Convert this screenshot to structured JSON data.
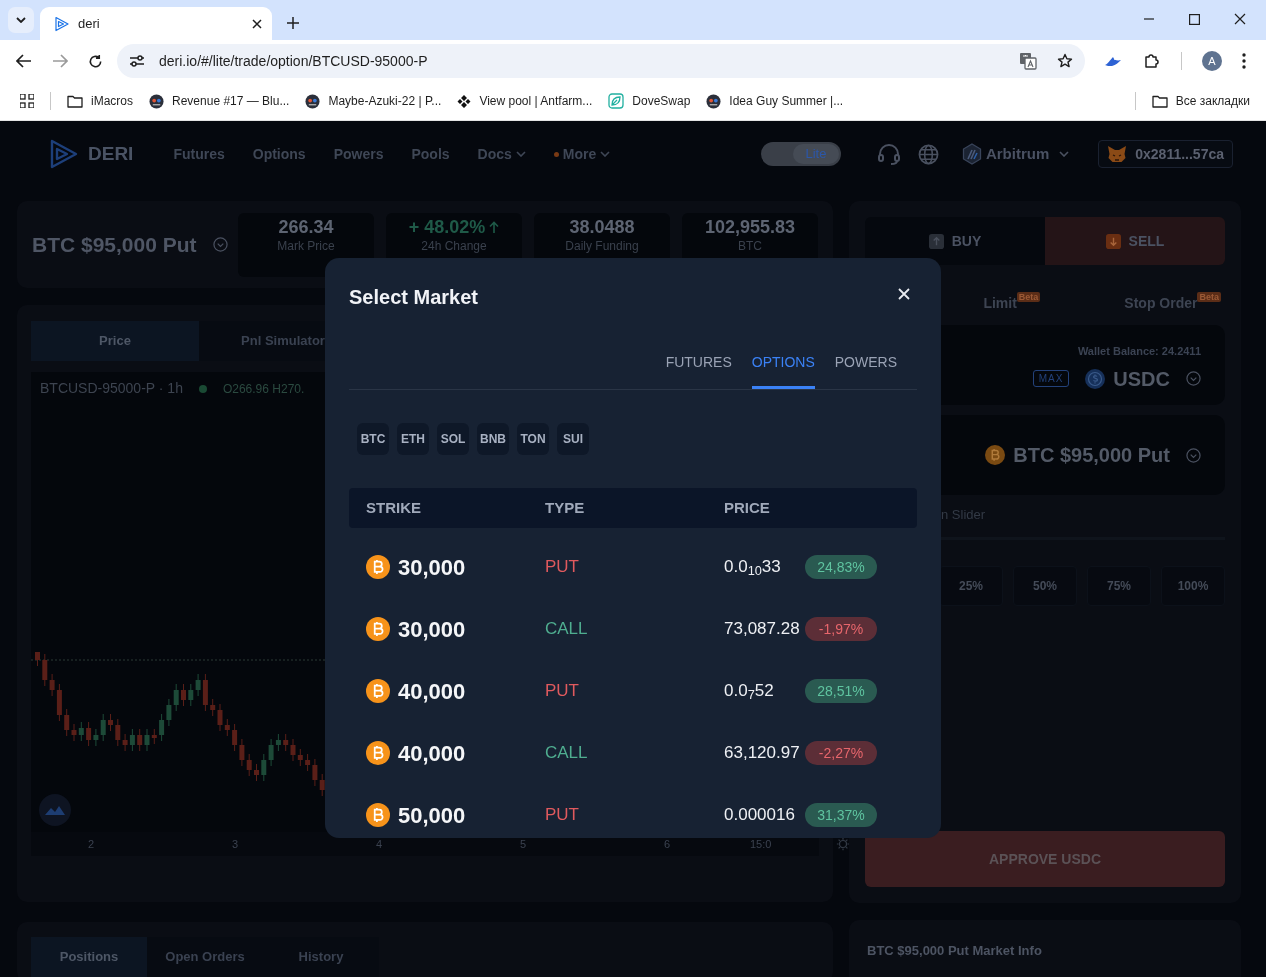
{
  "browser": {
    "tab_title": "deri",
    "url": "deri.io/#/lite/trade/option/BTCUSD-95000-P",
    "profile_initial": "A",
    "bookmarks": [
      {
        "label": "iMacros",
        "kind": "folder"
      },
      {
        "label": "Revenue #17 — Blu...",
        "kind": "site"
      },
      {
        "label": "Maybe-Azuki-22 | P...",
        "kind": "site"
      },
      {
        "label": "View pool | Antfarm...",
        "kind": "diamond"
      },
      {
        "label": "DoveSwap",
        "kind": "leaf"
      },
      {
        "label": "Idea Guy Summer |...",
        "kind": "site"
      }
    ],
    "all_bookmarks": "Все закладки"
  },
  "nav": {
    "logo": "DERI",
    "links": [
      {
        "label": "Futures",
        "dropdown": false,
        "dot": false
      },
      {
        "label": "Options",
        "dropdown": false,
        "dot": false
      },
      {
        "label": "Powers",
        "dropdown": false,
        "dot": false
      },
      {
        "label": "Pools",
        "dropdown": false,
        "dot": false
      },
      {
        "label": "Docs",
        "dropdown": true,
        "dot": false
      },
      {
        "label": "More",
        "dropdown": true,
        "dot": true
      }
    ],
    "mode_toggle": {
      "label": "Lite",
      "on": true
    },
    "network": "Arbitrum",
    "wallet": "0x2811...57ca"
  },
  "market_header": {
    "title": "BTC $95,000 Put",
    "stats": [
      {
        "value": "266.34",
        "label": "Mark Price",
        "kind": "plain"
      },
      {
        "value": "+ 48.02%",
        "label": "24h Change",
        "kind": "up"
      },
      {
        "value": "38.0488",
        "label": "Daily Funding",
        "kind": "plain"
      },
      {
        "value": "102,955.83",
        "label": "BTC",
        "kind": "plain"
      }
    ]
  },
  "chart_panel": {
    "tabs": [
      {
        "label": "Price",
        "selected": true
      },
      {
        "label": "Pnl Simulator",
        "selected": false
      }
    ],
    "symbol": "BTCUSD-95000-P · 1h",
    "ohlc": "O266.96 H270.",
    "x_labels": [
      "2",
      "3",
      "4",
      "5",
      "6",
      "15:0"
    ]
  },
  "bottom_tabs": [
    {
      "label": "Positions",
      "selected": true
    },
    {
      "label": "Open Orders",
      "selected": false
    },
    {
      "label": "History",
      "selected": false
    }
  ],
  "trade_panel": {
    "sides": [
      {
        "label": "BUY",
        "kind": "buy",
        "selected": false
      },
      {
        "label": "SELL",
        "kind": "sell",
        "selected": true
      }
    ],
    "order_types": [
      {
        "label": "Limit",
        "badge": "Beta",
        "selected": false
      },
      {
        "label": "Stop Order",
        "badge": "Beta",
        "selected": false
      }
    ],
    "wallet_balance": "Wallet Balance: 24.2411",
    "max": "MAX",
    "pay_token": "USDC",
    "market": "BTC $95,000 Put",
    "slider_label": "n Slider",
    "percent_buttons": [
      "25%",
      "50%",
      "75%",
      "100%"
    ],
    "approve": "APPROVE USDC"
  },
  "market_info": {
    "title": "BTC $95,000 Put Market Info"
  },
  "modal": {
    "title": "Select Market",
    "tabs": [
      {
        "label": "FUTURES",
        "selected": false
      },
      {
        "label": "OPTIONS",
        "selected": true
      },
      {
        "label": "POWERS",
        "selected": false
      }
    ],
    "assets": [
      "BTC",
      "ETH",
      "SOL",
      "BNB",
      "TON",
      "SUI"
    ],
    "columns": [
      "STRIKE",
      "TYPE",
      "PRICE"
    ],
    "rows": [
      {
        "strike": "30,000",
        "type": "PUT",
        "kind": "put",
        "price": "0.0$_{10}$33",
        "change": {
          "text": "24,83%",
          "kind": "up"
        }
      },
      {
        "strike": "30,000",
        "type": "CALL",
        "kind": "call",
        "price": "73,087.28",
        "change": {
          "text": "-1,97%",
          "kind": "down"
        }
      },
      {
        "strike": "40,000",
        "type": "PUT",
        "kind": "put",
        "price": "0.0$_{7}$52",
        "change": {
          "text": "28,51%",
          "kind": "up"
        }
      },
      {
        "strike": "40,000",
        "type": "CALL",
        "kind": "call",
        "price": "63,120.97",
        "change": {
          "text": "-2,27%",
          "kind": "down"
        }
      },
      {
        "strike": "50,000",
        "type": "PUT",
        "kind": "put",
        "price": "0.000016",
        "change": {
          "text": "31,37%",
          "kind": "up"
        }
      }
    ]
  }
}
